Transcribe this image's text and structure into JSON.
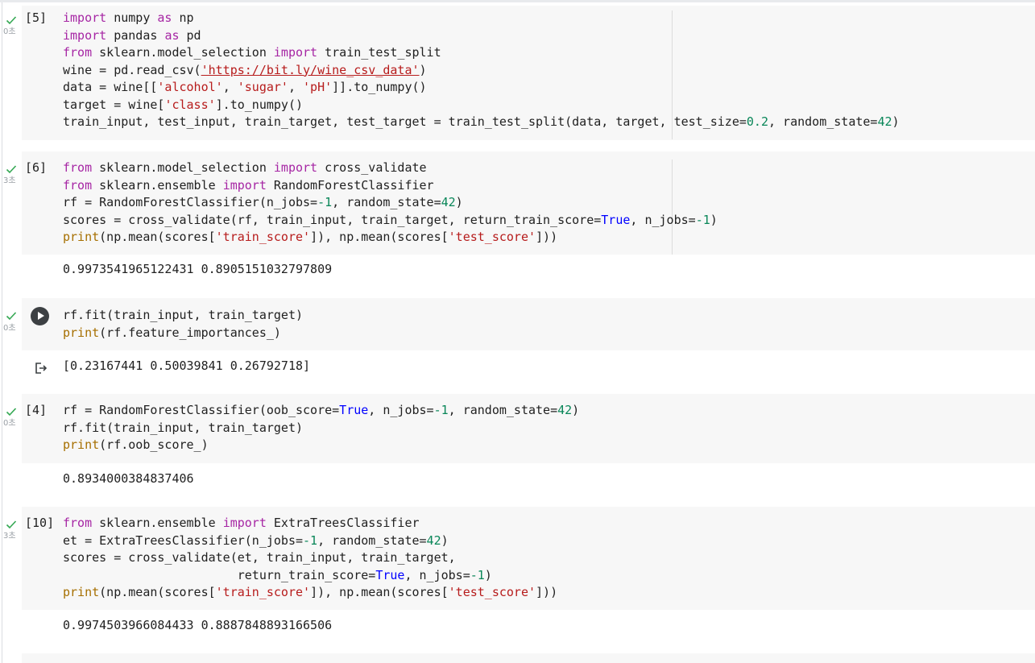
{
  "colors": {
    "keyword": "#a626a4",
    "builtin": "#a66f00",
    "string": "#b71c1c",
    "number": "#098658",
    "boolean": "#0000ff",
    "check": "#34a853",
    "cell_background": "#f7f7f7"
  },
  "icons": {
    "status": "check-icon",
    "run": "play-circle-icon",
    "output": "output-redirect-icon"
  },
  "cells": [
    {
      "exec_count": "[5]",
      "duration": "0초",
      "lines": [
        [
          [
            "kw",
            "import"
          ],
          [
            "t",
            " numpy "
          ],
          [
            "kw",
            "as"
          ],
          [
            "t",
            " np"
          ]
        ],
        [
          [
            "kw",
            "import"
          ],
          [
            "t",
            " pandas "
          ],
          [
            "kw",
            "as"
          ],
          [
            "t",
            " pd"
          ]
        ],
        [
          [
            "kw",
            "from"
          ],
          [
            "t",
            " sklearn.model_selection "
          ],
          [
            "kw",
            "import"
          ],
          [
            "t",
            " train_test_split"
          ]
        ],
        [
          [
            "t",
            "wine = pd.read_csv("
          ],
          [
            "url",
            "'https://bit.ly/wine_csv_data'"
          ],
          [
            "t",
            ")"
          ]
        ],
        [
          [
            "t",
            "data = wine[["
          ],
          [
            "str",
            "'alcohol'"
          ],
          [
            "t",
            ", "
          ],
          [
            "str",
            "'sugar'"
          ],
          [
            "t",
            ", "
          ],
          [
            "str",
            "'pH'"
          ],
          [
            "t",
            "]].to_numpy()"
          ]
        ],
        [
          [
            "t",
            "target = wine["
          ],
          [
            "str",
            "'class'"
          ],
          [
            "t",
            "].to_numpy()"
          ]
        ],
        [
          [
            "t",
            "train_input, test_input, train_target, test_target = train_test_split(data, target, test_size="
          ],
          [
            "num",
            "0.2"
          ],
          [
            "t",
            ", random_state="
          ],
          [
            "num",
            "42"
          ],
          [
            "t",
            ")"
          ]
        ]
      ],
      "output": ""
    },
    {
      "exec_count": "[6]",
      "duration": "3초",
      "lines": [
        [
          [
            "kw",
            "from"
          ],
          [
            "t",
            " sklearn.model_selection "
          ],
          [
            "kw",
            "import"
          ],
          [
            "t",
            " cross_validate"
          ]
        ],
        [
          [
            "kw",
            "from"
          ],
          [
            "t",
            " sklearn.ensemble "
          ],
          [
            "kw",
            "import"
          ],
          [
            "t",
            " RandomForestClassifier"
          ]
        ],
        [
          [
            "t",
            "rf = RandomForestClassifier(n_jobs="
          ],
          [
            "num",
            "-1"
          ],
          [
            "t",
            ", random_state="
          ],
          [
            "num",
            "42"
          ],
          [
            "t",
            ")"
          ]
        ],
        [
          [
            "t",
            "scores = cross_validate(rf, train_input, train_target, return_train_score="
          ],
          [
            "bool",
            "True"
          ],
          [
            "t",
            ", n_jobs="
          ],
          [
            "num",
            "-1"
          ],
          [
            "t",
            ")"
          ]
        ],
        [
          [
            "fn",
            "print"
          ],
          [
            "t",
            "(np.mean(scores["
          ],
          [
            "str",
            "'train_score'"
          ],
          [
            "t",
            "]), np.mean(scores["
          ],
          [
            "str",
            "'test_score'"
          ],
          [
            "t",
            "]))"
          ]
        ]
      ],
      "output": "0.9973541965122431 0.8905151032797809"
    },
    {
      "exec_count": "",
      "duration": "0초",
      "lines": [
        [
          [
            "t",
            "rf.fit(train_input, train_target)"
          ]
        ],
        [
          [
            "fn",
            "print"
          ],
          [
            "t",
            "(rf.feature_importances_)"
          ]
        ]
      ],
      "output": "[0.23167441 0.50039841 0.26792718]"
    },
    {
      "exec_count": "[4]",
      "duration": "0초",
      "lines": [
        [
          [
            "t",
            "rf = RandomForestClassifier(oob_score="
          ],
          [
            "bool",
            "True"
          ],
          [
            "t",
            ", n_jobs="
          ],
          [
            "num",
            "-1"
          ],
          [
            "t",
            ", random_state="
          ],
          [
            "num",
            "42"
          ],
          [
            "t",
            ")"
          ]
        ],
        [
          [
            "t",
            "rf.fit(train_input, train_target)"
          ]
        ],
        [
          [
            "fn",
            "print"
          ],
          [
            "t",
            "(rf.oob_score_)"
          ]
        ]
      ],
      "output": "0.8934000384837406"
    },
    {
      "exec_count": "[10]",
      "duration": "3초",
      "lines": [
        [
          [
            "kw",
            "from"
          ],
          [
            "t",
            " sklearn.ensemble "
          ],
          [
            "kw",
            "import"
          ],
          [
            "t",
            " ExtraTreesClassifier"
          ]
        ],
        [
          [
            "t",
            "et = ExtraTreesClassifier(n_jobs="
          ],
          [
            "num",
            "-1"
          ],
          [
            "t",
            ", random_state="
          ],
          [
            "num",
            "42"
          ],
          [
            "t",
            ")"
          ]
        ],
        [
          [
            "t",
            "scores = cross_validate(et, train_input, train_target,"
          ]
        ],
        [
          [
            "t",
            "                        return_train_score="
          ],
          [
            "bool",
            "True"
          ],
          [
            "t",
            ", n_jobs="
          ],
          [
            "num",
            "-1"
          ],
          [
            "t",
            ")"
          ]
        ],
        [
          [
            "fn",
            "print"
          ],
          [
            "t",
            "(np.mean(scores["
          ],
          [
            "str",
            "'train_score'"
          ],
          [
            "t",
            "]), np.mean(scores["
          ],
          [
            "str",
            "'test_score'"
          ],
          [
            "t",
            "]))"
          ]
        ]
      ],
      "output": "0.9974503966084433 0.8887848893166506"
    }
  ]
}
